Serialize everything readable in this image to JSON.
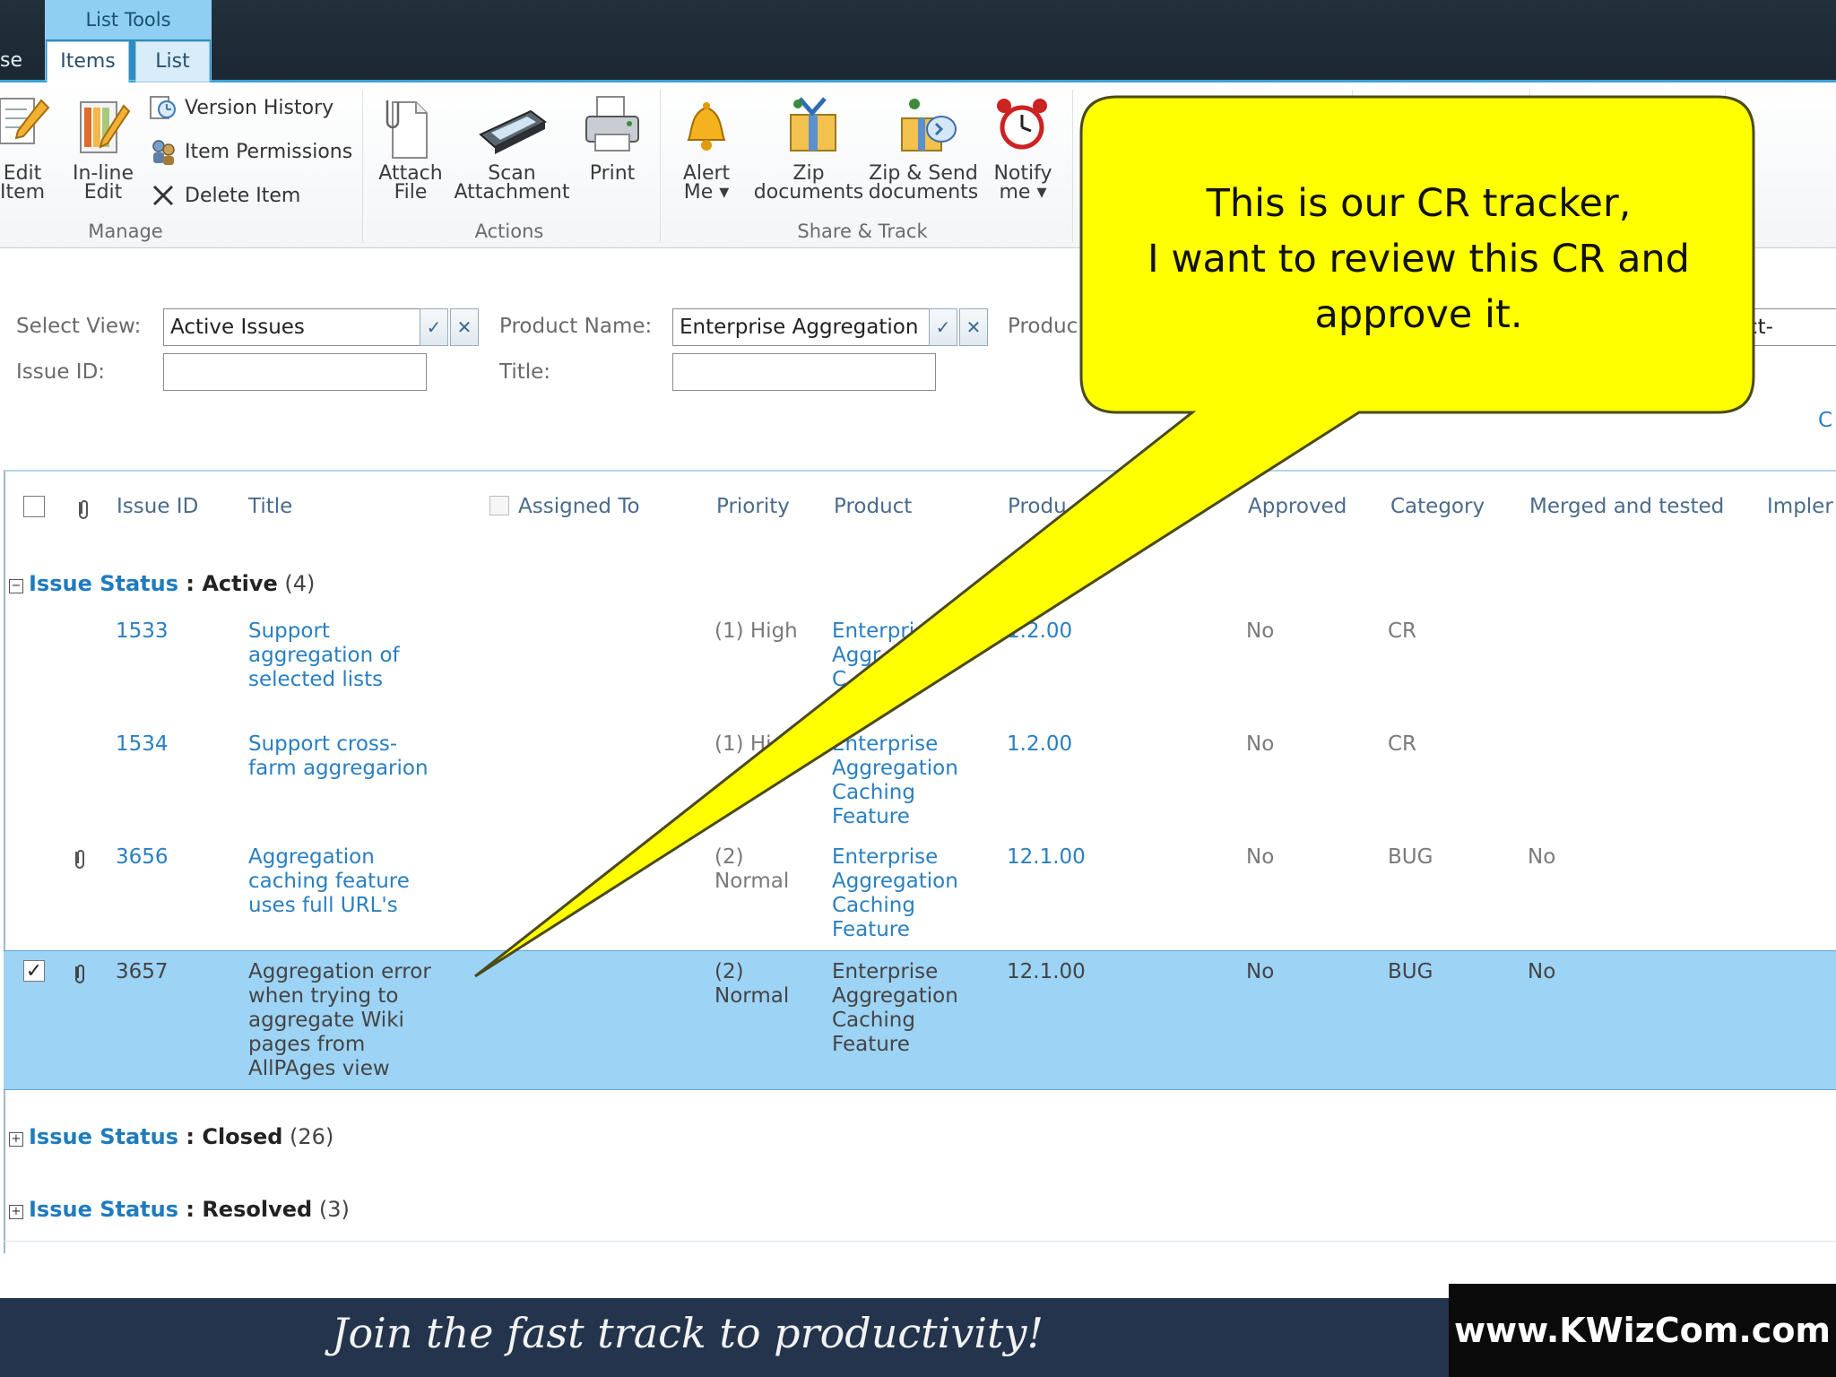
{
  "ribbon": {
    "context_group_title": "List Tools",
    "tabs": [
      "se",
      "Items",
      "List"
    ],
    "manage": {
      "edit_item": [
        "Edit",
        "Item"
      ],
      "inline_edit": [
        "In-line",
        "Edit"
      ],
      "version_history": "Version History",
      "item_permissions": "Item Permissions",
      "delete_item": "Delete Item",
      "group_label": "Manage"
    },
    "actions": {
      "attach_file": [
        "Attach",
        "File"
      ],
      "scan_attachment": [
        "Scan",
        "Attachment"
      ],
      "print": "Print",
      "group_label": "Actions"
    },
    "share_track": {
      "alert_me": [
        "Alert",
        "Me ▾"
      ],
      "zip_documents": [
        "Zip",
        "documents"
      ],
      "zip_send": [
        "Zip & Send",
        "documents"
      ],
      "notify_me": [
        "Notify",
        "me ▾"
      ],
      "group_label": "Share & Track"
    }
  },
  "filters": {
    "select_view_label": "Select View:",
    "select_view_value": "Active Issues",
    "product_name_label": "Product Name:",
    "product_name_value": "Enterprise Aggregation",
    "product_partial_label": "Produc",
    "right_partial_value": "ct-",
    "issue_id_label": "Issue ID:",
    "issue_id_value": "",
    "title_label": "Title:",
    "title_value": "",
    "right_link_partial": "C"
  },
  "table": {
    "headers": [
      "Issue ID",
      "Title",
      "Assigned To",
      "Priority",
      "Product",
      "Produ",
      "Approved",
      "Category",
      "Merged and tested",
      "Impler"
    ],
    "groups": [
      {
        "key": "Issue Status",
        "value": "Active",
        "count": "(4)",
        "expanded": true
      },
      {
        "key": "Issue Status",
        "value": "Closed",
        "count": "(26)",
        "expanded": false
      },
      {
        "key": "Issue Status",
        "value": "Resolved",
        "count": "(3)",
        "expanded": false
      }
    ],
    "rows": [
      {
        "id": "1533",
        "title": [
          "Support",
          "aggregation of",
          "selected lists"
        ],
        "priority": [
          "(1) High"
        ],
        "product": [
          "Enterpri",
          "Aggr",
          "C",
          "e"
        ],
        "version": "1.2.00",
        "approved": "No",
        "category": "CR",
        "merged": "",
        "attachment": false,
        "selected": false
      },
      {
        "id": "1534",
        "title": [
          "Support cross-",
          "farm aggregarion"
        ],
        "priority": [
          "(1) Hi"
        ],
        "product": [
          "Enterprise",
          "Aggregation",
          "Caching",
          "Feature"
        ],
        "version": "1.2.00",
        "approved": "No",
        "category": "CR",
        "merged": "",
        "attachment": false,
        "selected": false
      },
      {
        "id": "3656",
        "title": [
          "Aggregation",
          "caching feature",
          "uses full URL's"
        ],
        "priority": [
          "(2)",
          "Normal"
        ],
        "product": [
          "Enterprise",
          "Aggregation",
          "Caching",
          "Feature"
        ],
        "version": "12.1.00",
        "approved": "No",
        "category": "BUG",
        "merged": "No",
        "attachment": true,
        "selected": false
      },
      {
        "id": "3657",
        "title": [
          "Aggregation error",
          "when trying to",
          "aggregate Wiki",
          "pages from",
          "AllPAges view"
        ],
        "priority": [
          "(2)",
          "Normal"
        ],
        "product": [
          "Enterprise",
          "Aggregation",
          "Caching",
          "Feature"
        ],
        "version": "12.1.00",
        "approved": "No",
        "category": "BUG",
        "merged": "No",
        "attachment": true,
        "selected": true
      }
    ]
  },
  "callout": {
    "lines": [
      "This is our CR tracker,",
      "I want to review this CR and",
      "approve it."
    ],
    "fill": "#ffff00"
  },
  "footer": {
    "slogan": "Join the fast track to productivity!",
    "logo": "www.KWizCom.com"
  },
  "colors": {
    "accent": "#2a7fc0",
    "selected_row": "#9dd3f5",
    "topbar": "#1f2d39",
    "footer": "#23344c"
  }
}
